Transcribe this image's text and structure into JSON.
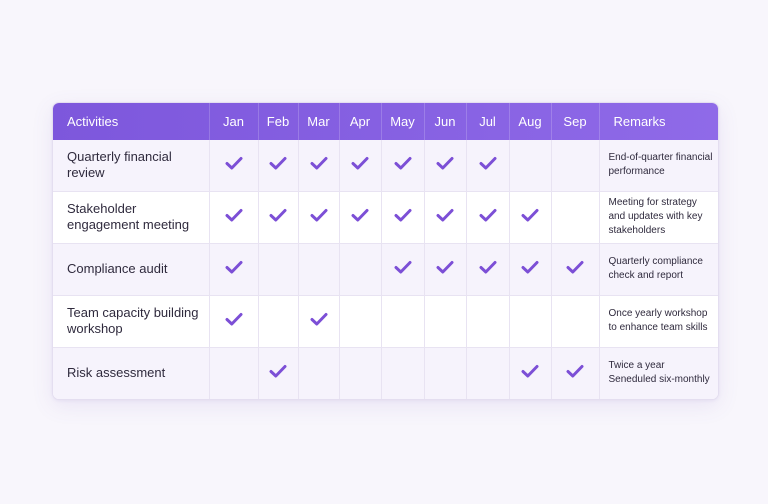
{
  "table": {
    "headers": {
      "activity": "Activities",
      "months": [
        "Jan",
        "Feb",
        "Mar",
        "Apr",
        "May",
        "Jun",
        "Jul",
        "Aug",
        "Sep"
      ],
      "remarks": "Remarks"
    },
    "rows": [
      {
        "activity": "Quarterly financial review",
        "checks": [
          true,
          true,
          true,
          true,
          true,
          true,
          true,
          false,
          false
        ],
        "remarks": "End-of-quarter financial performance"
      },
      {
        "activity": "Stakeholder engagement meeting",
        "checks": [
          true,
          true,
          true,
          true,
          true,
          true,
          true,
          true,
          false
        ],
        "remarks": "Meeting for strategy and updates with key stakeholders"
      },
      {
        "activity": "Compliance audit",
        "checks": [
          true,
          false,
          false,
          false,
          true,
          true,
          true,
          true,
          true
        ],
        "remarks": "Quarterly compliance check and report"
      },
      {
        "activity": "Team capacity building workshop",
        "checks": [
          true,
          false,
          true,
          false,
          false,
          false,
          false,
          false,
          false
        ],
        "remarks": "Once yearly workshop to enhance team skills"
      },
      {
        "activity": "Risk assessment",
        "checks": [
          false,
          true,
          false,
          false,
          false,
          false,
          false,
          true,
          true
        ],
        "remarks": "Twice a year Seneduled six-monthly"
      }
    ],
    "check_icon": "checkmark-icon",
    "check_color": "#7c4fd6",
    "header_color": "#7d57dc"
  }
}
